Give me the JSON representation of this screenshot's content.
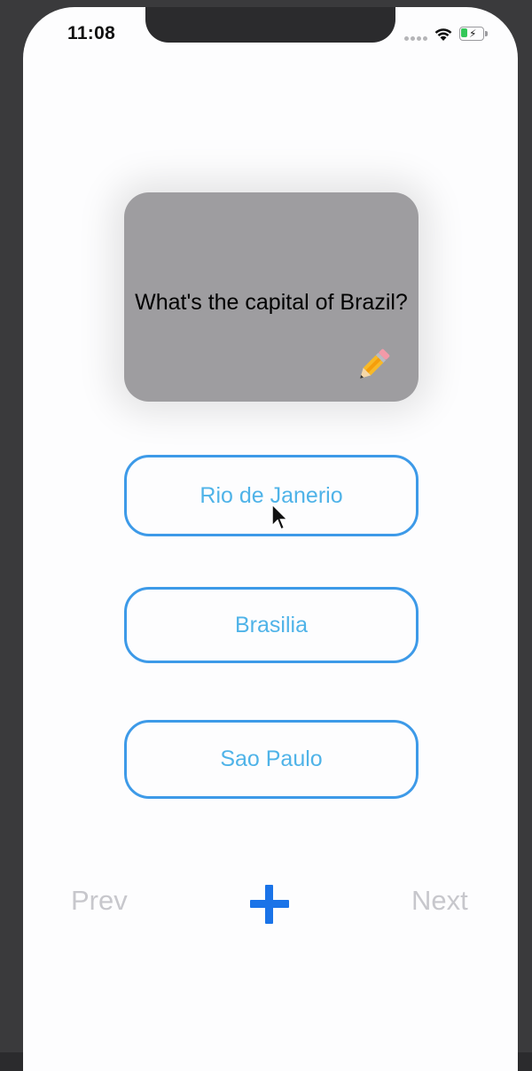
{
  "status_bar": {
    "time": "11:08"
  },
  "card": {
    "question": "What's the capital of Brazil?",
    "edit_icon": "pencil-icon"
  },
  "answers": [
    {
      "label": "Rio de Janerio"
    },
    {
      "label": "Brasilia"
    },
    {
      "label": "Sao Paulo"
    }
  ],
  "nav": {
    "prev_label": "Prev",
    "add_icon": "plus-icon",
    "next_label": "Next"
  },
  "colors": {
    "card_background": "#9e9da0",
    "answer_border": "#3d9ae8",
    "answer_text": "#4fb3e8",
    "add_icon": "#1a73e8",
    "nav_disabled": "#c7c7cc",
    "battery_charge": "#34c759"
  },
  "battery_level": 0.3
}
